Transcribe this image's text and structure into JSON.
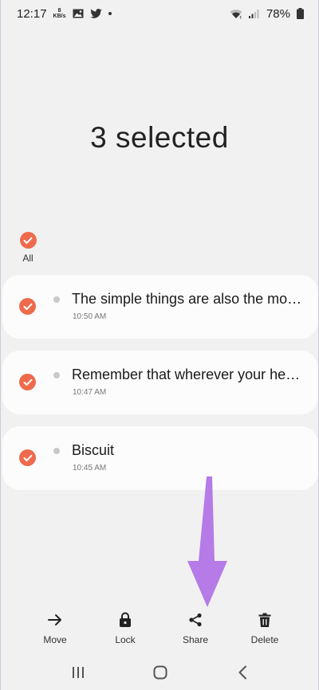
{
  "status_bar": {
    "time": "12:17",
    "net_speed_value": "8",
    "net_speed_unit": "KB/s",
    "battery": "78%"
  },
  "header": {
    "title": "3 selected"
  },
  "select_all": {
    "label": "All",
    "checked": true
  },
  "notes": [
    {
      "title": "The simple things are also the most extraordinary things",
      "time": "10:50 AM",
      "checked": true
    },
    {
      "title": "Remember that wherever your heart is, there you will find your treasure",
      "time": "10:47 AM",
      "checked": true
    },
    {
      "title": "Biscuit",
      "time": "10:45 AM",
      "checked": true
    }
  ],
  "actions": [
    {
      "label": "Move",
      "icon": "arrow-right-icon"
    },
    {
      "label": "Lock",
      "icon": "lock-icon"
    },
    {
      "label": "Share",
      "icon": "share-icon"
    },
    {
      "label": "Delete",
      "icon": "trash-icon"
    }
  ],
  "colors": {
    "accent": "#ee6b4d",
    "background": "#f1f1f1",
    "card": "#fcfcfc",
    "annotation_arrow": "#b67be6"
  }
}
